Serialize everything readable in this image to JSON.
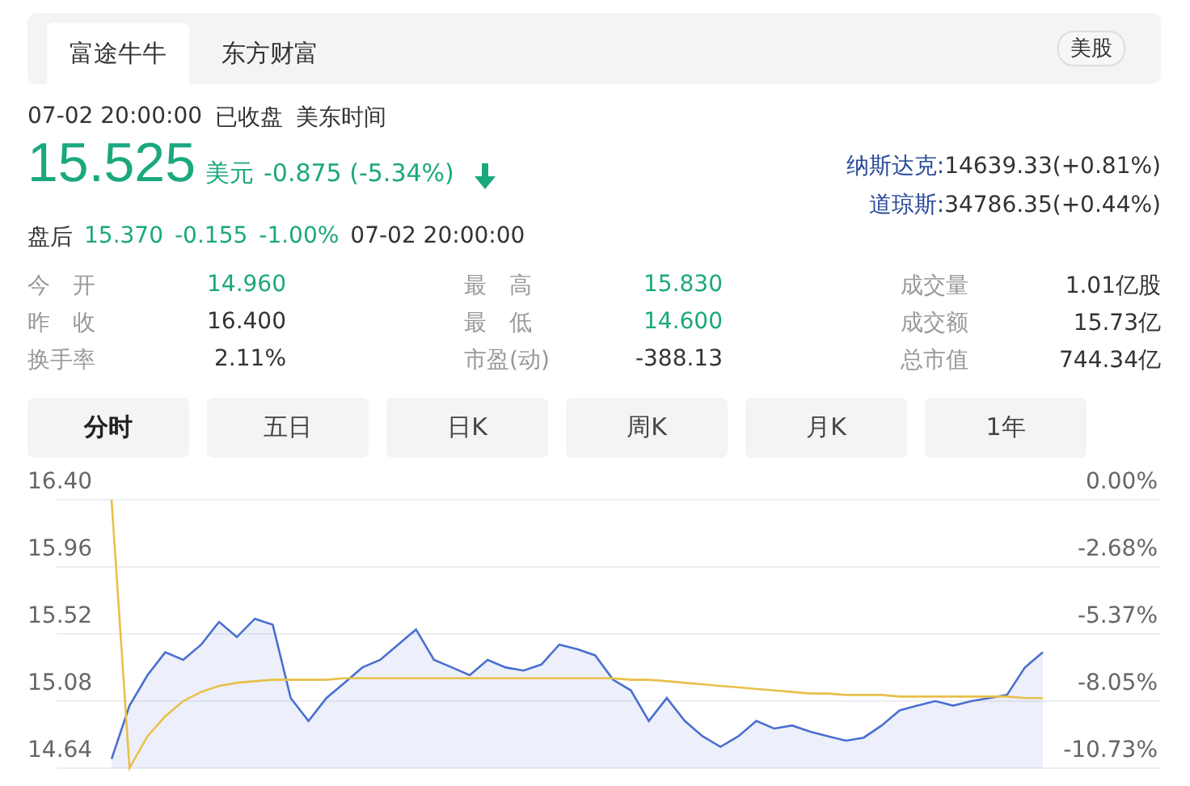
{
  "source_tabs": [
    {
      "label": "富途牛牛",
      "selected": true
    },
    {
      "label": "东方财富",
      "selected": false
    }
  ],
  "market_badge": "美股",
  "quote": {
    "timestamp": "07-02 20:00:00",
    "status": "已收盘",
    "timezone": "美东时间",
    "price": "15.525",
    "currency": "美元",
    "change": "-0.875 (-5.34%)",
    "after_hours": {
      "label": "盘后",
      "price": "15.370",
      "change": "-0.155",
      "percent": "-1.00%",
      "time": "07-02 20:00:00"
    }
  },
  "indices": [
    {
      "name": "纳斯达克:",
      "value": "14639.33(+0.81%)"
    },
    {
      "name": "道琼斯:",
      "value": "34786.35(+0.44%)"
    }
  ],
  "stats": [
    {
      "label": "今　开",
      "value": "14.960",
      "highlight": true
    },
    {
      "label": "最　高",
      "value": "15.830",
      "highlight": true
    },
    {
      "label": "成交量",
      "value": "1.01亿股",
      "highlight": false
    },
    {
      "label": "昨　收",
      "value": "16.400",
      "highlight": false
    },
    {
      "label": "最　低",
      "value": "14.600",
      "highlight": true
    },
    {
      "label": "成交额",
      "value": "15.73亿",
      "highlight": false
    },
    {
      "label": "换手率",
      "value": "2.11%",
      "highlight": false
    },
    {
      "label": "市盈(动)",
      "value": "-388.13",
      "highlight": false
    },
    {
      "label": "总市值",
      "value": "744.34亿",
      "highlight": false
    }
  ],
  "period_tabs": [
    {
      "label": "分时",
      "selected": true
    },
    {
      "label": "五日",
      "selected": false
    },
    {
      "label": "日K",
      "selected": false
    },
    {
      "label": "周K",
      "selected": false
    },
    {
      "label": "月K",
      "selected": false
    },
    {
      "label": "1年",
      "selected": false
    }
  ],
  "chart": {
    "percent_labels": [
      "0.00%",
      "-2.68%",
      "-5.37%",
      "-8.05%",
      "-10.73%"
    ],
    "chart_data": {
      "type": "line",
      "grid": true,
      "ylim": [
        14.64,
        16.4
      ],
      "yticks": [
        {
          "value": 16.4,
          "label": "16.40"
        },
        {
          "value": 15.96,
          "label": "15.96"
        },
        {
          "value": 15.52,
          "label": "15.52"
        },
        {
          "value": 15.08,
          "label": "15.08"
        },
        {
          "value": 14.64,
          "label": "14.64"
        }
      ],
      "series": [
        {
          "color": "#4a6fd0",
          "values": [
            14.7,
            15.05,
            15.25,
            15.4,
            15.35,
            15.45,
            15.6,
            15.5,
            15.62,
            15.58,
            15.1,
            14.95,
            15.1,
            15.2,
            15.3,
            15.35,
            15.45,
            15.55,
            15.35,
            15.3,
            15.25,
            15.35,
            15.3,
            15.28,
            15.32,
            15.45,
            15.42,
            15.38,
            15.22,
            15.15,
            14.95,
            15.1,
            14.95,
            14.85,
            14.78,
            14.85,
            14.95,
            14.9,
            14.92,
            14.88,
            14.85,
            14.82,
            14.84,
            14.92,
            15.02,
            15.05,
            15.08,
            15.05,
            15.08,
            15.1,
            15.12,
            15.3,
            15.4
          ]
        },
        {
          "color": "#e8c04a",
          "values": [
            16.4,
            14.64,
            14.85,
            14.98,
            15.08,
            15.14,
            15.18,
            15.2,
            15.21,
            15.22,
            15.22,
            15.22,
            15.22,
            15.23,
            15.23,
            15.23,
            15.23,
            15.23,
            15.23,
            15.23,
            15.23,
            15.23,
            15.23,
            15.23,
            15.23,
            15.23,
            15.23,
            15.23,
            15.23,
            15.22,
            15.22,
            15.21,
            15.2,
            15.19,
            15.18,
            15.17,
            15.16,
            15.15,
            15.14,
            15.13,
            15.13,
            15.12,
            15.12,
            15.12,
            15.11,
            15.11,
            15.11,
            15.11,
            15.11,
            15.11,
            15.11,
            15.1,
            15.1
          ]
        }
      ]
    }
  }
}
